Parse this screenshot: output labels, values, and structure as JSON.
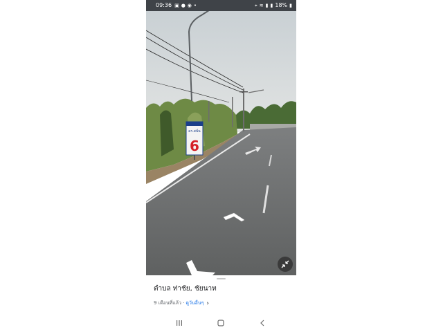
{
  "status_bar": {
    "time": "09:36",
    "notification_icons": [
      "gallery-icon",
      "chat-icon",
      "message-icon",
      "dot-icon"
    ],
    "battery": "18%"
  },
  "street_view": {
    "sign_text_line1": "ดร.สนั่น",
    "sign_number": "6"
  },
  "info": {
    "location": "ตำบล ท่าชัย, ชัยนาท",
    "date": "9 เดือนที่แล้ว · ",
    "see_more": "ดูวันอื่นๆ",
    "chevron": "›"
  },
  "nav": {
    "recent": "|||",
    "home": "○",
    "back": "<"
  }
}
